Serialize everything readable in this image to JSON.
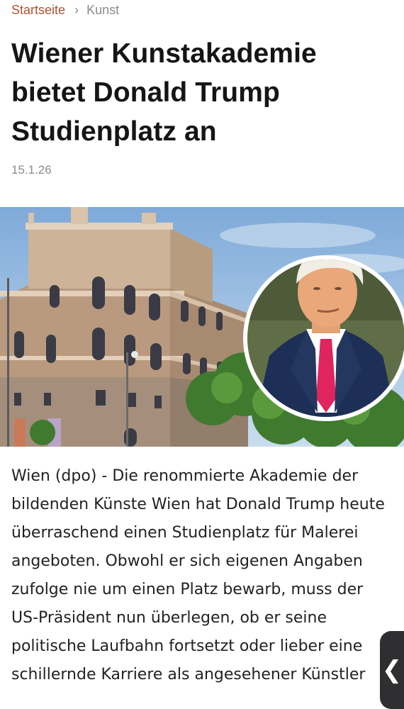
{
  "breadcrumb": {
    "home": "Startseite",
    "separator": "›",
    "current": "Kunst"
  },
  "article": {
    "title": "Wiener Kunstakademie bietet Donald Trump Studienplatz an",
    "date": "15.1.26",
    "body": "Wien (dpo) - Die renommierte Akademie der bildenden Künste Wien hat Donald Trump heute überraschend einen Studienplatz für Malerei angeboten. Obwohl er sich eigenen Angaben zufolge nie um einen Platz bewarb, muss der US-Präsident nun überlegen, ob er seine politische Laufbahn fortsetzt oder lieber eine schillernde Karriere als angesehener Künstler"
  },
  "ui": {
    "back_tab_icon": "chevron-left-icon",
    "back_tab_glyph": "❮"
  },
  "colors": {
    "breadcrumb_link": "#b0522f",
    "muted": "#8c8c8c",
    "tie": "#e0245e",
    "suit": "#1e2f57"
  }
}
